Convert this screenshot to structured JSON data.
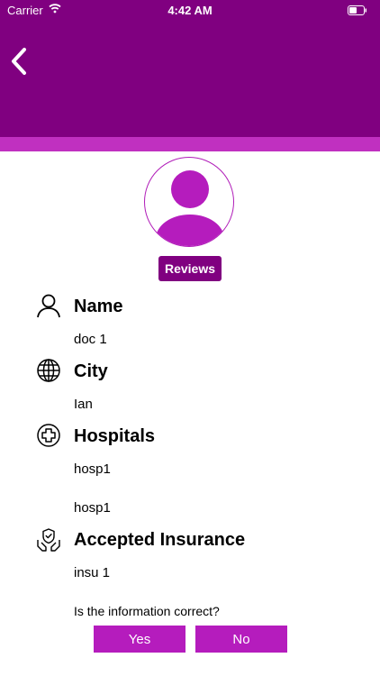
{
  "status_bar": {
    "carrier": "Carrier",
    "time": "4:42 AM"
  },
  "profile": {
    "reviews_label": "Reviews"
  },
  "sections": [
    {
      "title": "Name",
      "values": [
        "doc 1"
      ]
    },
    {
      "title": "City",
      "values": [
        "Ian"
      ]
    },
    {
      "title": "Hospitals",
      "values": [
        "hosp1",
        "hosp1"
      ]
    },
    {
      "title": "Accepted Insurance",
      "values": [
        "insu 1"
      ]
    }
  ],
  "confirm": {
    "question": "Is the information correct?",
    "yes_label": "Yes",
    "no_label": "No"
  },
  "colors": {
    "header": "#800080",
    "stripe": "#c030c0",
    "accent": "#b51cbd"
  }
}
